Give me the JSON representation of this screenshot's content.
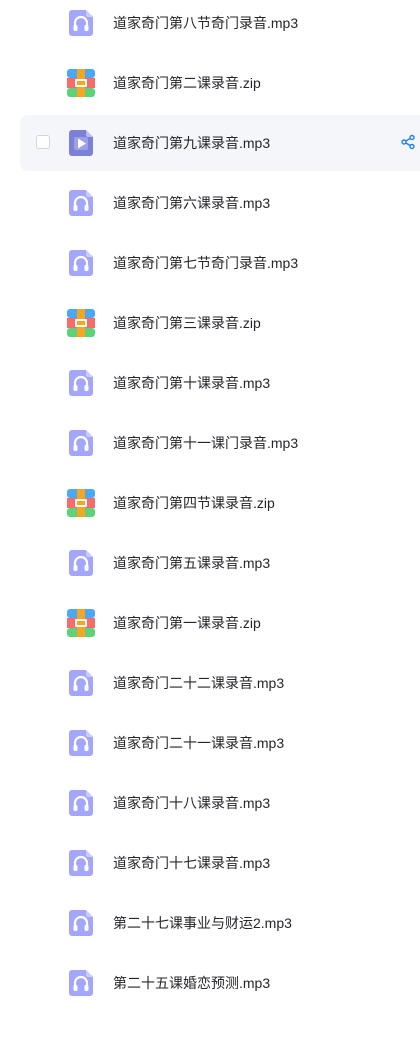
{
  "colors": {
    "audio_icon": "#a3a6fa",
    "video_icon": "#7c80d8",
    "zip_blue": "#4aa8f7",
    "zip_red": "#f56c6c",
    "zip_green": "#5dd27a",
    "zip_orange": "#f5a623",
    "share_icon": "#1f7eff",
    "row_highlight": "#f5f6fa"
  },
  "files": [
    {
      "name": "道家奇门第八节奇门录音.mp3",
      "icon": "audio-icon",
      "active": false
    },
    {
      "name": "道家奇门第二课录音.zip",
      "icon": "zip-icon",
      "active": false
    },
    {
      "name": "道家奇门第九课录音.mp3",
      "icon": "video-icon",
      "active": true
    },
    {
      "name": "道家奇门第六课录音.mp3",
      "icon": "audio-icon",
      "active": false
    },
    {
      "name": "道家奇门第七节奇门录音.mp3",
      "icon": "audio-icon",
      "active": false
    },
    {
      "name": "道家奇门第三课录音.zip",
      "icon": "zip-icon",
      "active": false
    },
    {
      "name": "道家奇门第十课录音.mp3",
      "icon": "audio-icon",
      "active": false
    },
    {
      "name": "道家奇门第十一课门录音.mp3",
      "icon": "audio-icon",
      "active": false
    },
    {
      "name": "道家奇门第四节课录音.zip",
      "icon": "zip-icon",
      "active": false
    },
    {
      "name": "道家奇门第五课录音.mp3",
      "icon": "audio-icon",
      "active": false
    },
    {
      "name": "道家奇门第一课录音.zip",
      "icon": "zip-icon",
      "active": false
    },
    {
      "name": "道家奇门二十二课录音.mp3",
      "icon": "audio-icon",
      "active": false
    },
    {
      "name": "道家奇门二十一课录音.mp3",
      "icon": "audio-icon",
      "active": false
    },
    {
      "name": "道家奇门十八课录音.mp3",
      "icon": "audio-icon",
      "active": false
    },
    {
      "name": "道家奇门十七课录音.mp3",
      "icon": "audio-icon",
      "active": false
    },
    {
      "name": "第二十七课事业与财运2.mp3",
      "icon": "audio-icon",
      "active": false
    },
    {
      "name": "第二十五课婚恋预测.mp3",
      "icon": "audio-icon",
      "active": false
    }
  ]
}
